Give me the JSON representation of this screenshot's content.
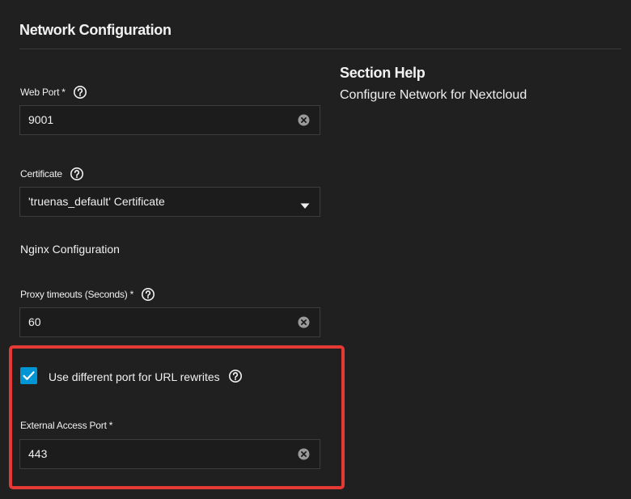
{
  "section": {
    "title": "Network Configuration"
  },
  "fields": {
    "web_port": {
      "label": "Web Port",
      "required_mark": "*",
      "value": "9001",
      "help_icon": "help-circle-icon",
      "clear_icon": "clear-circle-icon"
    },
    "certificate": {
      "label": "Certificate",
      "value": "'truenas_default' Certificate",
      "help_icon": "help-circle-icon",
      "dropdown_icon": "caret-down-icon"
    },
    "nginx": {
      "heading": "Nginx Configuration"
    },
    "proxy_timeouts": {
      "label": "Proxy timeouts (Seconds)",
      "required_mark": "*",
      "value": "60",
      "help_icon": "help-circle-icon",
      "clear_icon": "clear-circle-icon"
    },
    "url_rewrite": {
      "label": "Use different port for URL rewrites",
      "checked": true,
      "help_icon": "help-circle-icon"
    },
    "external_port": {
      "label": "External Access Port",
      "required_mark": "*",
      "value": "443",
      "clear_icon": "clear-circle-icon"
    }
  },
  "help_panel": {
    "title": "Section Help",
    "text": "Configure Network for Nextcloud"
  },
  "colors": {
    "background": "#202020",
    "accent": "#0095d5",
    "highlight": "#e53935"
  }
}
